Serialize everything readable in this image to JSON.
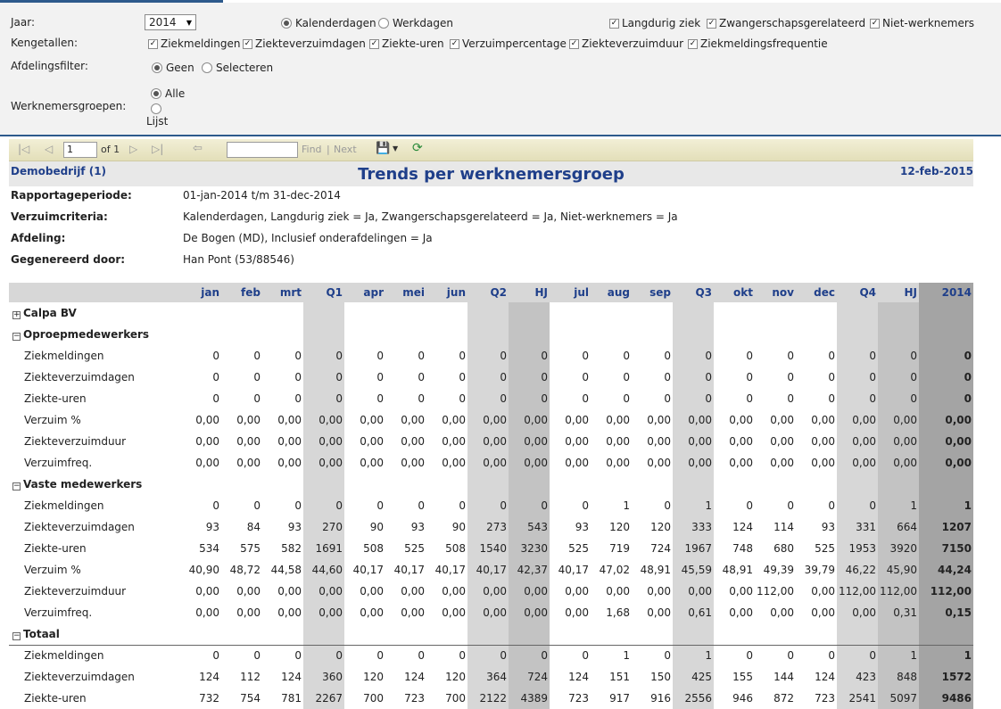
{
  "filters": {
    "jaar_label": "Jaar:",
    "jaar_value": "2014",
    "kengetallen_label": "Kengetallen:",
    "afdelingsfilter_label": "Afdelingsfilter:",
    "werknemersgroepen_label": "Werknemersgroepen:",
    "kalenderdagen": "Kalenderdagen",
    "werkdagen": "Werkdagen",
    "langdurig_ziek": "Langdurig ziek",
    "zwangerschap": "Zwangerschapsgerelateerd",
    "niet_werknemers": "Niet-werknemers",
    "k_ziekmeldingen": "Ziekmeldingen",
    "k_ziekteverzuimdagen": "Ziekteverzuimdagen",
    "k_ziekte_uren": "Ziekte-uren",
    "k_verzuimpercentage": "Verzuimpercentage",
    "k_ziekteverzuimduur": "Ziekteverzuimduur",
    "k_ziekmeldingsfrequentie": "Ziekmeldingsfrequentie",
    "geen": "Geen",
    "selecteren": "Selecteren",
    "alle": "Alle",
    "lijst": "Lijst"
  },
  "toolbar": {
    "page": "1",
    "of": "of 1",
    "find": "Find",
    "sep": "|",
    "next": "Next"
  },
  "report": {
    "company": "Demobedrijf (1)",
    "title": "Trends per werknemersgroep",
    "date": "12-feb-2015",
    "info": [
      {
        "key": "Rapportageperiode:",
        "value": "01-jan-2014 t/m 31-dec-2014"
      },
      {
        "key": "Verzuimcriteria:",
        "value": "Kalenderdagen, Langdurig ziek = Ja, Zwangerschapsgerelateerd = Ja, Niet-werknemers = Ja"
      },
      {
        "key": "Afdeling:",
        "value": "De Bogen (MD), Inclusief onderafdelingen = Ja"
      },
      {
        "key": "Gegenereerd door:",
        "value": "Han Pont (53/88546)"
      }
    ]
  },
  "table": {
    "columns": [
      "jan",
      "feb",
      "mrt",
      "Q1",
      "apr",
      "mei",
      "jun",
      "Q2",
      "HJ",
      "jul",
      "aug",
      "sep",
      "Q3",
      "okt",
      "nov",
      "dec",
      "Q4",
      "HJ",
      "2014"
    ],
    "rows": [
      {
        "type": "group",
        "icon": "+",
        "name": "Calpa BV"
      },
      {
        "type": "group",
        "icon": "−",
        "name": "Oproepmedewerkers"
      },
      {
        "type": "data",
        "name": "Ziekmeldingen",
        "values": [
          "0",
          "0",
          "0",
          "0",
          "0",
          "0",
          "0",
          "0",
          "0",
          "0",
          "0",
          "0",
          "0",
          "0",
          "0",
          "0",
          "0",
          "0",
          "0"
        ]
      },
      {
        "type": "data",
        "name": "Ziekteverzuimdagen",
        "values": [
          "0",
          "0",
          "0",
          "0",
          "0",
          "0",
          "0",
          "0",
          "0",
          "0",
          "0",
          "0",
          "0",
          "0",
          "0",
          "0",
          "0",
          "0",
          "0"
        ]
      },
      {
        "type": "data",
        "name": "Ziekte-uren",
        "values": [
          "0",
          "0",
          "0",
          "0",
          "0",
          "0",
          "0",
          "0",
          "0",
          "0",
          "0",
          "0",
          "0",
          "0",
          "0",
          "0",
          "0",
          "0",
          "0"
        ]
      },
      {
        "type": "data",
        "name": "Verzuim %",
        "values": [
          "0,00",
          "0,00",
          "0,00",
          "0,00",
          "0,00",
          "0,00",
          "0,00",
          "0,00",
          "0,00",
          "0,00",
          "0,00",
          "0,00",
          "0,00",
          "0,00",
          "0,00",
          "0,00",
          "0,00",
          "0,00",
          "0,00"
        ]
      },
      {
        "type": "data",
        "name": "Ziekteverzuimduur",
        "values": [
          "0,00",
          "0,00",
          "0,00",
          "0,00",
          "0,00",
          "0,00",
          "0,00",
          "0,00",
          "0,00",
          "0,00",
          "0,00",
          "0,00",
          "0,00",
          "0,00",
          "0,00",
          "0,00",
          "0,00",
          "0,00",
          "0,00"
        ]
      },
      {
        "type": "data",
        "name": "Verzuimfreq.",
        "values": [
          "0,00",
          "0,00",
          "0,00",
          "0,00",
          "0,00",
          "0,00",
          "0,00",
          "0,00",
          "0,00",
          "0,00",
          "0,00",
          "0,00",
          "0,00",
          "0,00",
          "0,00",
          "0,00",
          "0,00",
          "0,00",
          "0,00"
        ]
      },
      {
        "type": "group",
        "icon": "−",
        "name": "Vaste medewerkers"
      },
      {
        "type": "data",
        "name": "Ziekmeldingen",
        "values": [
          "0",
          "0",
          "0",
          "0",
          "0",
          "0",
          "0",
          "0",
          "0",
          "0",
          "1",
          "0",
          "1",
          "0",
          "0",
          "0",
          "0",
          "1",
          "1"
        ]
      },
      {
        "type": "data",
        "name": "Ziekteverzuimdagen",
        "values": [
          "93",
          "84",
          "93",
          "270",
          "90",
          "93",
          "90",
          "273",
          "543",
          "93",
          "120",
          "120",
          "333",
          "124",
          "114",
          "93",
          "331",
          "664",
          "1207"
        ]
      },
      {
        "type": "data",
        "name": "Ziekte-uren",
        "values": [
          "534",
          "575",
          "582",
          "1691",
          "508",
          "525",
          "508",
          "1540",
          "3230",
          "525",
          "719",
          "724",
          "1967",
          "748",
          "680",
          "525",
          "1953",
          "3920",
          "7150"
        ]
      },
      {
        "type": "data",
        "name": "Verzuim %",
        "values": [
          "40,90",
          "48,72",
          "44,58",
          "44,60",
          "40,17",
          "40,17",
          "40,17",
          "40,17",
          "42,37",
          "40,17",
          "47,02",
          "48,91",
          "45,59",
          "48,91",
          "49,39",
          "39,79",
          "46,22",
          "45,90",
          "44,24"
        ]
      },
      {
        "type": "data",
        "name": "Ziekteverzuimduur",
        "values": [
          "0,00",
          "0,00",
          "0,00",
          "0,00",
          "0,00",
          "0,00",
          "0,00",
          "0,00",
          "0,00",
          "0,00",
          "0,00",
          "0,00",
          "0,00",
          "0,00",
          "112,00",
          "0,00",
          "112,00",
          "112,00",
          "112,00"
        ]
      },
      {
        "type": "data",
        "name": "Verzuimfreq.",
        "values": [
          "0,00",
          "0,00",
          "0,00",
          "0,00",
          "0,00",
          "0,00",
          "0,00",
          "0,00",
          "0,00",
          "0,00",
          "1,68",
          "0,00",
          "0,61",
          "0,00",
          "0,00",
          "0,00",
          "0,00",
          "0,31",
          "0,15"
        ]
      },
      {
        "type": "group",
        "icon": "−",
        "name": "Totaal"
      },
      {
        "type": "data",
        "sep": true,
        "name": "Ziekmeldingen",
        "values": [
          "0",
          "0",
          "0",
          "0",
          "0",
          "0",
          "0",
          "0",
          "0",
          "0",
          "1",
          "0",
          "1",
          "0",
          "0",
          "0",
          "0",
          "1",
          "1"
        ]
      },
      {
        "type": "data",
        "name": "Ziekteverzuimdagen",
        "values": [
          "124",
          "112",
          "124",
          "360",
          "120",
          "124",
          "120",
          "364",
          "724",
          "124",
          "151",
          "150",
          "425",
          "155",
          "144",
          "124",
          "423",
          "848",
          "1572"
        ]
      },
      {
        "type": "data",
        "name": "Ziekte-uren",
        "values": [
          "732",
          "754",
          "781",
          "2267",
          "700",
          "723",
          "700",
          "2122",
          "4389",
          "723",
          "917",
          "916",
          "2556",
          "946",
          "872",
          "723",
          "2541",
          "5097",
          "9486"
        ]
      }
    ]
  }
}
